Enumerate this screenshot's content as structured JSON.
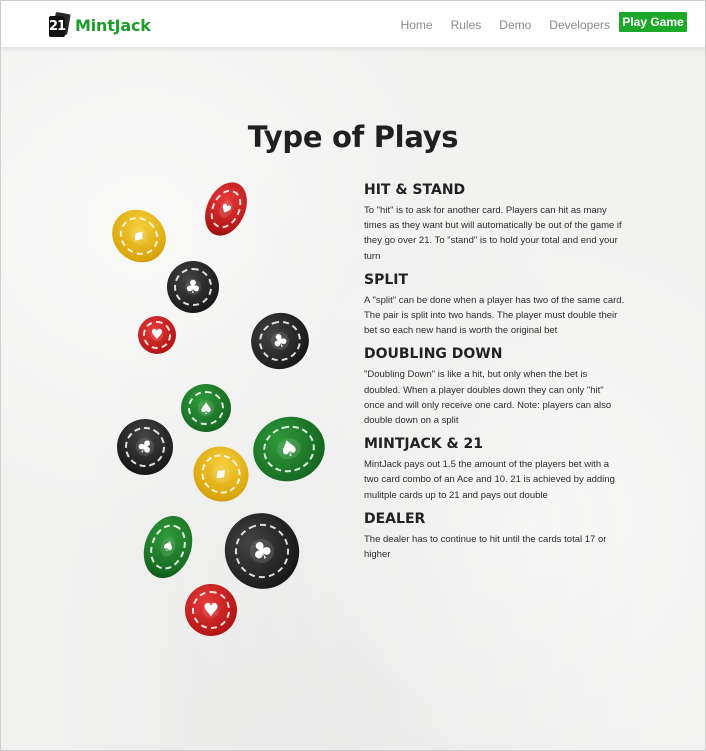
{
  "nav": {
    "brand_logo_text": "21",
    "brand_name": "MintJack",
    "links": [
      "Home",
      "Rules",
      "Demo",
      "Developers"
    ],
    "cta": "Play Game"
  },
  "colors": {
    "brand_green": "#1f9d2b",
    "button_green": "#1ea82a",
    "chip_yellow": "#e8b81c",
    "chip_red": "#c42020",
    "chip_black": "#1b1b1b",
    "chip_green": "#1b7a27"
  },
  "page_title": "Type of Plays",
  "plays": [
    {
      "heading": "HIT & STAND",
      "body": "To \"hit\" is to ask for another card. Players can hit as many times as they want but will automatically be out of the game if they go over 21. To \"stand\" is to hold your total and end your turn"
    },
    {
      "heading": "SPLIT",
      "body": "A \"split\" can be done when a player has two of the same card. The pair is split into two hands. The player must double their bet so each new hand is worth the original bet"
    },
    {
      "heading": "DOUBLING DOWN",
      "body": "\"Doubling Down\" is like a hit, but only when the bet is doubled. When a player doubles down they can only \"hit\" once and will only receive one card. Note: players can also double down on a split"
    },
    {
      "heading": "MINTJACK & 21",
      "body": "MintJack pays out 1.5 the amount of the players bet with a two card combo of an Ace and 10. 21 is achieved by adding mulitple cards up to 21 and pays out double"
    },
    {
      "heading": "DEALER",
      "body": "The dealer has to continue to hit until the cards total 17 or higher"
    }
  ],
  "chips_illustration": [
    {
      "color": "red",
      "suit": "heart-icon",
      "symbol": "♥"
    },
    {
      "color": "yellow",
      "suit": "diamond-icon",
      "symbol": "♦"
    },
    {
      "color": "black",
      "suit": "club-icon",
      "symbol": "♣"
    },
    {
      "color": "red",
      "suit": "heart-icon",
      "symbol": "♥"
    },
    {
      "color": "black",
      "suit": "club-icon",
      "symbol": "♣"
    },
    {
      "color": "green",
      "suit": "spade-icon",
      "symbol": "♠"
    },
    {
      "color": "black",
      "suit": "club-icon",
      "symbol": "♣"
    },
    {
      "color": "green",
      "suit": "spade-icon",
      "symbol": "♠"
    },
    {
      "color": "yellow",
      "suit": "diamond-icon",
      "symbol": "♦"
    },
    {
      "color": "green",
      "suit": "spade-icon",
      "symbol": "♠"
    },
    {
      "color": "black",
      "suit": "club-icon",
      "symbol": "♣"
    },
    {
      "color": "red",
      "suit": "heart-icon",
      "symbol": "♥"
    }
  ]
}
